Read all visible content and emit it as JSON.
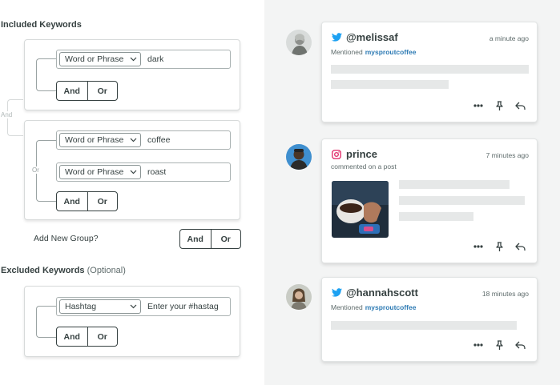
{
  "included": {
    "title": "Included Keywords",
    "outer_label": "And"
  },
  "group1": {
    "rows": [
      {
        "type": "Word or Phrase",
        "value": "dark"
      }
    ],
    "and_label": "And",
    "or_label": "Or"
  },
  "group2": {
    "bracket_label": "Or",
    "rows": [
      {
        "type": "Word or Phrase",
        "value": "coffee"
      },
      {
        "type": "Word or Phrase",
        "value": "roast"
      }
    ],
    "and_label": "And",
    "or_label": "Or"
  },
  "add_group": {
    "label": "Add New Group?",
    "and_label": "And",
    "or_label": "Or"
  },
  "excluded": {
    "title": "Excluded Keywords",
    "optional": "(Optional)",
    "rows": [
      {
        "type": "Hashtag",
        "placeholder": "Enter your #hastag"
      }
    ],
    "and_label": "And",
    "or_label": "Or"
  },
  "feed": [
    {
      "network": "twitter",
      "handle": "@melissaf",
      "time": "a minute ago",
      "meta_prefix": "Mentioned",
      "meta_account": "mysproutcoffee"
    },
    {
      "network": "instagram",
      "handle": "prince",
      "time": "7 minutes ago",
      "meta_prefix": "commented on a post",
      "meta_account": ""
    },
    {
      "network": "twitter",
      "handle": "@hannahscott",
      "time": "18 minutes ago",
      "meta_prefix": "Mentioned",
      "meta_account": "mysproutcoffee"
    }
  ],
  "colors": {
    "twitter": "#1da1f2",
    "instagram": "#e1306c",
    "link": "#2e7bb4",
    "text": "#364141",
    "panel_bg": "#f3f4f4"
  },
  "icons": {
    "more": "more-icon",
    "pin": "pin-icon",
    "reply": "reply-icon",
    "chevron": "chevron-down-icon"
  }
}
